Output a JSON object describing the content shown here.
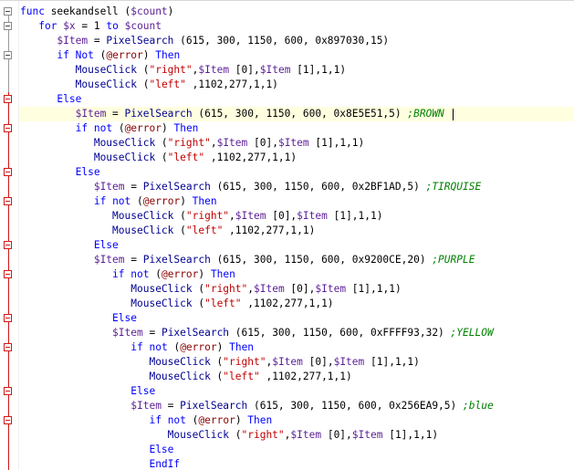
{
  "editor": {
    "lines": [
      {
        "indent": 0,
        "tokens": [
          {
            "t": "kw",
            "v": "func"
          },
          {
            "t": "op",
            "v": " seekandsell ("
          },
          {
            "t": "var",
            "v": "$count"
          },
          {
            "t": "op",
            "v": ")"
          }
        ]
      },
      {
        "indent": 1,
        "tokens": [
          {
            "t": "kw",
            "v": "for"
          },
          {
            "t": "op",
            "v": " "
          },
          {
            "t": "var",
            "v": "$x"
          },
          {
            "t": "op",
            "v": " = 1 "
          },
          {
            "t": "kw",
            "v": "to"
          },
          {
            "t": "op",
            "v": " "
          },
          {
            "t": "var",
            "v": "$count"
          }
        ]
      },
      {
        "indent": 2,
        "tokens": [
          {
            "t": "var",
            "v": "$Item"
          },
          {
            "t": "op",
            "v": " = "
          },
          {
            "t": "fn",
            "v": "PixelSearch"
          },
          {
            "t": "op",
            "v": " (615, 300, 1150, 600, 0x897030,15)"
          }
        ]
      },
      {
        "indent": 2,
        "tokens": [
          {
            "t": "kw",
            "v": "if"
          },
          {
            "t": "op",
            "v": " "
          },
          {
            "t": "kw",
            "v": "Not"
          },
          {
            "t": "op",
            "v": " ("
          },
          {
            "t": "macro",
            "v": "@error"
          },
          {
            "t": "op",
            "v": ") "
          },
          {
            "t": "kw",
            "v": "Then"
          }
        ]
      },
      {
        "indent": 3,
        "tokens": [
          {
            "t": "fn",
            "v": "MouseClick"
          },
          {
            "t": "op",
            "v": " ("
          },
          {
            "t": "str",
            "v": "\"right\""
          },
          {
            "t": "op",
            "v": ","
          },
          {
            "t": "var",
            "v": "$Item"
          },
          {
            "t": "op",
            "v": " [0],"
          },
          {
            "t": "var",
            "v": "$Item"
          },
          {
            "t": "op",
            "v": " [1],1,1)"
          }
        ]
      },
      {
        "indent": 3,
        "tokens": [
          {
            "t": "fn",
            "v": "MouseClick"
          },
          {
            "t": "op",
            "v": " ("
          },
          {
            "t": "str",
            "v": "\"left\""
          },
          {
            "t": "op",
            "v": " ,1102,277,1,1)"
          }
        ]
      },
      {
        "indent": 2,
        "tokens": [
          {
            "t": "kw",
            "v": "Else"
          }
        ]
      },
      {
        "indent": 3,
        "current": true,
        "tokens": [
          {
            "t": "var",
            "v": "$Item"
          },
          {
            "t": "op",
            "v": " = "
          },
          {
            "t": "fn",
            "v": "PixelSearch"
          },
          {
            "t": "op",
            "v": " (615, 300, 1150, 600, 0x8E5E51,5) "
          },
          {
            "t": "cmt",
            "v": ";BROWN "
          }
        ]
      },
      {
        "indent": 3,
        "tokens": [
          {
            "t": "kw",
            "v": "if"
          },
          {
            "t": "op",
            "v": " "
          },
          {
            "t": "kw",
            "v": "not"
          },
          {
            "t": "op",
            "v": " ("
          },
          {
            "t": "macro",
            "v": "@error"
          },
          {
            "t": "op",
            "v": ") "
          },
          {
            "t": "kw",
            "v": "Then"
          }
        ]
      },
      {
        "indent": 4,
        "tokens": [
          {
            "t": "fn",
            "v": "MouseClick"
          },
          {
            "t": "op",
            "v": " ("
          },
          {
            "t": "str",
            "v": "\"right\""
          },
          {
            "t": "op",
            "v": ","
          },
          {
            "t": "var",
            "v": "$Item"
          },
          {
            "t": "op",
            "v": " [0],"
          },
          {
            "t": "var",
            "v": "$Item"
          },
          {
            "t": "op",
            "v": " [1],1,1)"
          }
        ]
      },
      {
        "indent": 4,
        "tokens": [
          {
            "t": "fn",
            "v": "MouseClick"
          },
          {
            "t": "op",
            "v": " ("
          },
          {
            "t": "str",
            "v": "\"left\""
          },
          {
            "t": "op",
            "v": " ,1102,277,1,1)"
          }
        ]
      },
      {
        "indent": 3,
        "tokens": [
          {
            "t": "kw",
            "v": "Else"
          }
        ]
      },
      {
        "indent": 4,
        "tokens": [
          {
            "t": "var",
            "v": "$Item"
          },
          {
            "t": "op",
            "v": " = "
          },
          {
            "t": "fn",
            "v": "PixelSearch"
          },
          {
            "t": "op",
            "v": " (615, 300, 1150, 600, 0x2BF1AD,5) "
          },
          {
            "t": "cmt",
            "v": ";TIRQUISE"
          }
        ]
      },
      {
        "indent": 4,
        "tokens": [
          {
            "t": "kw",
            "v": "if"
          },
          {
            "t": "op",
            "v": " "
          },
          {
            "t": "kw",
            "v": "not"
          },
          {
            "t": "op",
            "v": " ("
          },
          {
            "t": "macro",
            "v": "@error"
          },
          {
            "t": "op",
            "v": ") "
          },
          {
            "t": "kw",
            "v": "Then"
          }
        ]
      },
      {
        "indent": 5,
        "tokens": [
          {
            "t": "fn",
            "v": "MouseClick"
          },
          {
            "t": "op",
            "v": " ("
          },
          {
            "t": "str",
            "v": "\"right\""
          },
          {
            "t": "op",
            "v": ","
          },
          {
            "t": "var",
            "v": "$Item"
          },
          {
            "t": "op",
            "v": " [0],"
          },
          {
            "t": "var",
            "v": "$Item"
          },
          {
            "t": "op",
            "v": " [1],1,1)"
          }
        ]
      },
      {
        "indent": 5,
        "tokens": [
          {
            "t": "fn",
            "v": "MouseClick"
          },
          {
            "t": "op",
            "v": " ("
          },
          {
            "t": "str",
            "v": "\"left\""
          },
          {
            "t": "op",
            "v": " ,1102,277,1,1)"
          }
        ]
      },
      {
        "indent": 4,
        "tokens": [
          {
            "t": "kw",
            "v": "Else"
          }
        ]
      },
      {
        "indent": 4,
        "tokens": [
          {
            "t": "var",
            "v": "$Item"
          },
          {
            "t": "op",
            "v": " = "
          },
          {
            "t": "fn",
            "v": "PixelSearch"
          },
          {
            "t": "op",
            "v": " (615, 300, 1150, 600, 0x9200CE,20) "
          },
          {
            "t": "cmt",
            "v": ";PURPLE"
          }
        ]
      },
      {
        "indent": 5,
        "tokens": [
          {
            "t": "kw",
            "v": "if"
          },
          {
            "t": "op",
            "v": " "
          },
          {
            "t": "kw",
            "v": "not"
          },
          {
            "t": "op",
            "v": " ("
          },
          {
            "t": "macro",
            "v": "@error"
          },
          {
            "t": "op",
            "v": ") "
          },
          {
            "t": "kw",
            "v": "Then"
          }
        ]
      },
      {
        "indent": 6,
        "tokens": [
          {
            "t": "fn",
            "v": "MouseClick"
          },
          {
            "t": "op",
            "v": " ("
          },
          {
            "t": "str",
            "v": "\"right\""
          },
          {
            "t": "op",
            "v": ","
          },
          {
            "t": "var",
            "v": "$Item"
          },
          {
            "t": "op",
            "v": " [0],"
          },
          {
            "t": "var",
            "v": "$Item"
          },
          {
            "t": "op",
            "v": " [1],1,1)"
          }
        ]
      },
      {
        "indent": 6,
        "tokens": [
          {
            "t": "fn",
            "v": "MouseClick"
          },
          {
            "t": "op",
            "v": " ("
          },
          {
            "t": "str",
            "v": "\"left\""
          },
          {
            "t": "op",
            "v": " ,1102,277,1,1)"
          }
        ]
      },
      {
        "indent": 5,
        "tokens": [
          {
            "t": "kw",
            "v": "Else"
          }
        ]
      },
      {
        "indent": 5,
        "tokens": [
          {
            "t": "var",
            "v": "$Item"
          },
          {
            "t": "op",
            "v": " = "
          },
          {
            "t": "fn",
            "v": "PixelSearch"
          },
          {
            "t": "op",
            "v": " (615, 300, 1150, 600, 0xFFFF93,32) "
          },
          {
            "t": "cmt",
            "v": ";YELLOW"
          }
        ]
      },
      {
        "indent": 6,
        "tokens": [
          {
            "t": "kw",
            "v": "if"
          },
          {
            "t": "op",
            "v": " "
          },
          {
            "t": "kw",
            "v": "not"
          },
          {
            "t": "op",
            "v": " ("
          },
          {
            "t": "macro",
            "v": "@error"
          },
          {
            "t": "op",
            "v": ") "
          },
          {
            "t": "kw",
            "v": "Then"
          }
        ]
      },
      {
        "indent": 7,
        "tokens": [
          {
            "t": "fn",
            "v": "MouseClick"
          },
          {
            "t": "op",
            "v": " ("
          },
          {
            "t": "str",
            "v": "\"right\""
          },
          {
            "t": "op",
            "v": ","
          },
          {
            "t": "var",
            "v": "$Item"
          },
          {
            "t": "op",
            "v": " [0],"
          },
          {
            "t": "var",
            "v": "$Item"
          },
          {
            "t": "op",
            "v": " [1],1,1)"
          }
        ]
      },
      {
        "indent": 7,
        "tokens": [
          {
            "t": "fn",
            "v": "MouseClick"
          },
          {
            "t": "op",
            "v": " ("
          },
          {
            "t": "str",
            "v": "\"left\""
          },
          {
            "t": "op",
            "v": " ,1102,277,1,1)"
          }
        ]
      },
      {
        "indent": 6,
        "tokens": [
          {
            "t": "kw",
            "v": "Else"
          }
        ]
      },
      {
        "indent": 6,
        "tokens": [
          {
            "t": "var",
            "v": "$Item"
          },
          {
            "t": "op",
            "v": " = "
          },
          {
            "t": "fn",
            "v": "PixelSearch"
          },
          {
            "t": "op",
            "v": " (615, 300, 1150, 600, 0x256EA9,5) "
          },
          {
            "t": "cmt",
            "v": ";blue"
          }
        ]
      },
      {
        "indent": 7,
        "tokens": [
          {
            "t": "kw",
            "v": "if"
          },
          {
            "t": "op",
            "v": " "
          },
          {
            "t": "kw",
            "v": "not"
          },
          {
            "t": "op",
            "v": " ("
          },
          {
            "t": "macro",
            "v": "@error"
          },
          {
            "t": "op",
            "v": ") "
          },
          {
            "t": "kw",
            "v": "Then"
          }
        ]
      },
      {
        "indent": 8,
        "tokens": [
          {
            "t": "fn",
            "v": "MouseClick"
          },
          {
            "t": "op",
            "v": " ("
          },
          {
            "t": "str",
            "v": "\"right\""
          },
          {
            "t": "op",
            "v": ","
          },
          {
            "t": "var",
            "v": "$Item"
          },
          {
            "t": "op",
            "v": " [0],"
          },
          {
            "t": "var",
            "v": "$Item"
          },
          {
            "t": "op",
            "v": " [1],1,1)"
          }
        ]
      },
      {
        "indent": 7,
        "tokens": [
          {
            "t": "kw",
            "v": "Else"
          }
        ]
      },
      {
        "indent": 7,
        "tokens": [
          {
            "t": "kw",
            "v": "EndIf"
          }
        ]
      }
    ],
    "folds": [
      {
        "line": 0,
        "color": "grey"
      },
      {
        "line": 1,
        "color": "grey"
      },
      {
        "line": 3,
        "color": "grey"
      },
      {
        "line": 6,
        "color": "red"
      },
      {
        "line": 8,
        "color": "red"
      },
      {
        "line": 11,
        "color": "red"
      },
      {
        "line": 13,
        "color": "red"
      },
      {
        "line": 16,
        "color": "red"
      },
      {
        "line": 18,
        "color": "red"
      },
      {
        "line": 21,
        "color": "red"
      },
      {
        "line": 23,
        "color": "red"
      },
      {
        "line": 26,
        "color": "red"
      },
      {
        "line": 28,
        "color": "red"
      }
    ],
    "colors": {
      "keyword": "#0000ff",
      "function": "#000090",
      "variable": "#5a1e96",
      "string": "#c00000",
      "macro": "#8b0000",
      "comment": "#008000",
      "current_line_bg": "#ffffe0",
      "fold_grey": "#9a9a9a",
      "fold_red": "#d01818"
    }
  }
}
